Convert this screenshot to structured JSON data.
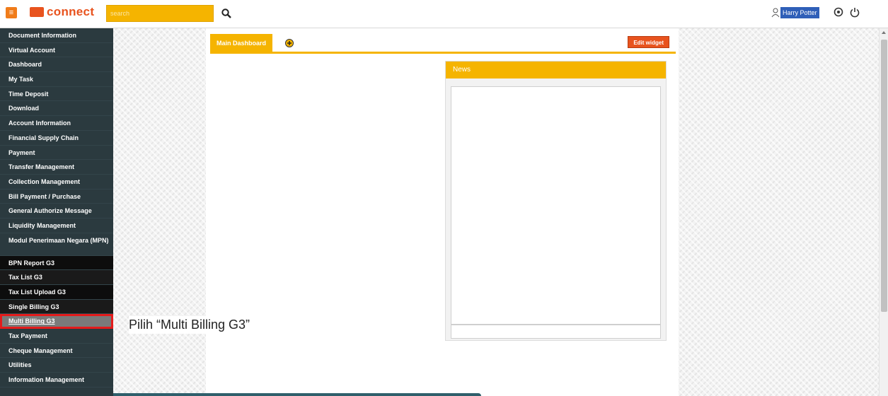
{
  "header": {
    "menu_icon": "hamburger-icon",
    "logo_text": "connect",
    "search_placeholder": "search",
    "user_name": "Harry Potter",
    "icons": [
      "search-icon",
      "user-icon",
      "settings-icon",
      "power-icon"
    ]
  },
  "sidebar": {
    "items": [
      {
        "label": "Document Information"
      },
      {
        "label": "Virtual Account"
      },
      {
        "label": "Dashboard"
      },
      {
        "label": "My Task"
      },
      {
        "label": "Time Deposit"
      },
      {
        "label": "Download"
      },
      {
        "label": "Account Information"
      },
      {
        "label": "Financial Supply Chain"
      },
      {
        "label": "Payment"
      },
      {
        "label": "Transfer Management"
      },
      {
        "label": "Collection Management"
      },
      {
        "label": "Bill Payment / Purchase"
      },
      {
        "label": "General Authorize Message"
      },
      {
        "label": "Liquidity Management"
      },
      {
        "label": "Modul Penerimaan Negara (MPN)"
      },
      {
        "label": "BPN Report G3"
      },
      {
        "label": "Tax List G3"
      },
      {
        "label": "Tax List Upload G3"
      },
      {
        "label": "Single Billing G3"
      },
      {
        "label": "Multi Billing G3"
      },
      {
        "label": "Tax Payment"
      },
      {
        "label": "Cheque Management"
      },
      {
        "label": "Utilities"
      },
      {
        "label": "Information Management"
      }
    ],
    "selected": "Multi Billing G3"
  },
  "dashboard": {
    "tab_label": "Main Dashboard",
    "add_tab_icon": "plus-circle-icon",
    "edit_widget_label": "Edit widget"
  },
  "news_widget": {
    "title": "News"
  },
  "annotation": {
    "text": "Pilih “Multi Billing G3”"
  },
  "colors": {
    "accent": "#f5b400",
    "brand": "#e8531e",
    "sidebar_bg": "#2b3a3f",
    "highlight": "#e41b1b"
  }
}
